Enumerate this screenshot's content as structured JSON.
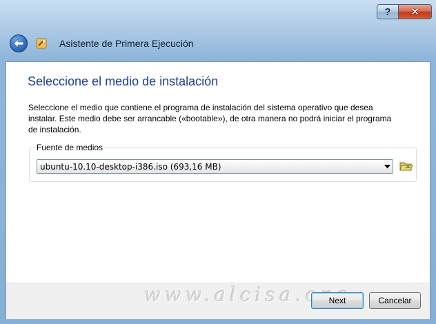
{
  "window": {
    "title": "Asistente de Primera Ejecución",
    "help_label": "?",
    "close_label": "✕"
  },
  "page": {
    "title": "Seleccione el medio de instalación",
    "description": "Seleccione el medio que contiene el programa de instalación del sistema operativo que desea instalar. Este medio debe ser arrancable («bootable»), de otra manera no podrá iniciar el programa de instalación."
  },
  "media": {
    "group_label": "Fuente de medios",
    "selected": "ubuntu-10.10-desktop-i386.iso (693,16 MB)"
  },
  "footer": {
    "watermark": "www.alcisa.org",
    "next_label": "Next",
    "cancel_label": "Cancelar"
  },
  "icons": [
    "back-arrow-icon",
    "wizard-icon",
    "dropdown-arrow-icon",
    "open-folder-icon"
  ],
  "colors": {
    "title_blue": "#1e3f96",
    "close_red": "#c03b1a",
    "default_button_border": "#3c7fb1"
  }
}
